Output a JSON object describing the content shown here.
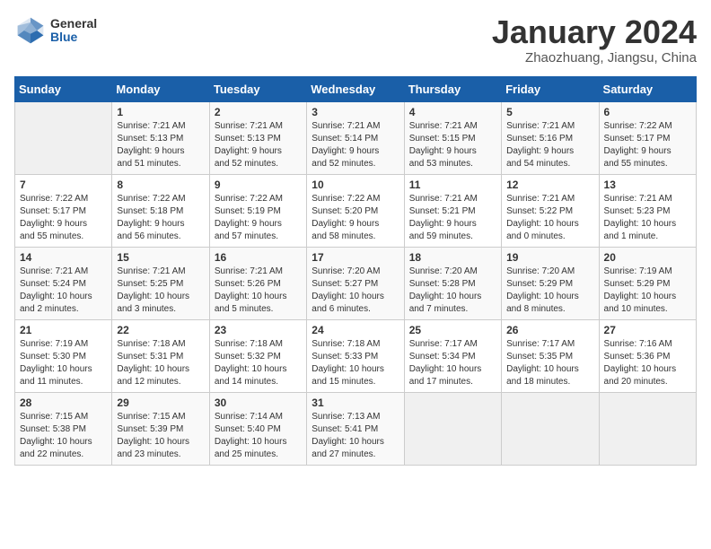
{
  "header": {
    "logo": {
      "line1": "General",
      "line2": "Blue"
    },
    "title": "January 2024",
    "location": "Zhaozhuang, Jiangsu, China"
  },
  "weekdays": [
    "Sunday",
    "Monday",
    "Tuesday",
    "Wednesday",
    "Thursday",
    "Friday",
    "Saturday"
  ],
  "weeks": [
    [
      {
        "day": "",
        "info": ""
      },
      {
        "day": "1",
        "info": "Sunrise: 7:21 AM\nSunset: 5:13 PM\nDaylight: 9 hours\nand 51 minutes."
      },
      {
        "day": "2",
        "info": "Sunrise: 7:21 AM\nSunset: 5:13 PM\nDaylight: 9 hours\nand 52 minutes."
      },
      {
        "day": "3",
        "info": "Sunrise: 7:21 AM\nSunset: 5:14 PM\nDaylight: 9 hours\nand 52 minutes."
      },
      {
        "day": "4",
        "info": "Sunrise: 7:21 AM\nSunset: 5:15 PM\nDaylight: 9 hours\nand 53 minutes."
      },
      {
        "day": "5",
        "info": "Sunrise: 7:21 AM\nSunset: 5:16 PM\nDaylight: 9 hours\nand 54 minutes."
      },
      {
        "day": "6",
        "info": "Sunrise: 7:22 AM\nSunset: 5:17 PM\nDaylight: 9 hours\nand 55 minutes."
      }
    ],
    [
      {
        "day": "7",
        "info": "Sunrise: 7:22 AM\nSunset: 5:17 PM\nDaylight: 9 hours\nand 55 minutes."
      },
      {
        "day": "8",
        "info": "Sunrise: 7:22 AM\nSunset: 5:18 PM\nDaylight: 9 hours\nand 56 minutes."
      },
      {
        "day": "9",
        "info": "Sunrise: 7:22 AM\nSunset: 5:19 PM\nDaylight: 9 hours\nand 57 minutes."
      },
      {
        "day": "10",
        "info": "Sunrise: 7:22 AM\nSunset: 5:20 PM\nDaylight: 9 hours\nand 58 minutes."
      },
      {
        "day": "11",
        "info": "Sunrise: 7:21 AM\nSunset: 5:21 PM\nDaylight: 9 hours\nand 59 minutes."
      },
      {
        "day": "12",
        "info": "Sunrise: 7:21 AM\nSunset: 5:22 PM\nDaylight: 10 hours\nand 0 minutes."
      },
      {
        "day": "13",
        "info": "Sunrise: 7:21 AM\nSunset: 5:23 PM\nDaylight: 10 hours\nand 1 minute."
      }
    ],
    [
      {
        "day": "14",
        "info": "Sunrise: 7:21 AM\nSunset: 5:24 PM\nDaylight: 10 hours\nand 2 minutes."
      },
      {
        "day": "15",
        "info": "Sunrise: 7:21 AM\nSunset: 5:25 PM\nDaylight: 10 hours\nand 3 minutes."
      },
      {
        "day": "16",
        "info": "Sunrise: 7:21 AM\nSunset: 5:26 PM\nDaylight: 10 hours\nand 5 minutes."
      },
      {
        "day": "17",
        "info": "Sunrise: 7:20 AM\nSunset: 5:27 PM\nDaylight: 10 hours\nand 6 minutes."
      },
      {
        "day": "18",
        "info": "Sunrise: 7:20 AM\nSunset: 5:28 PM\nDaylight: 10 hours\nand 7 minutes."
      },
      {
        "day": "19",
        "info": "Sunrise: 7:20 AM\nSunset: 5:29 PM\nDaylight: 10 hours\nand 8 minutes."
      },
      {
        "day": "20",
        "info": "Sunrise: 7:19 AM\nSunset: 5:29 PM\nDaylight: 10 hours\nand 10 minutes."
      }
    ],
    [
      {
        "day": "21",
        "info": "Sunrise: 7:19 AM\nSunset: 5:30 PM\nDaylight: 10 hours\nand 11 minutes."
      },
      {
        "day": "22",
        "info": "Sunrise: 7:18 AM\nSunset: 5:31 PM\nDaylight: 10 hours\nand 12 minutes."
      },
      {
        "day": "23",
        "info": "Sunrise: 7:18 AM\nSunset: 5:32 PM\nDaylight: 10 hours\nand 14 minutes."
      },
      {
        "day": "24",
        "info": "Sunrise: 7:18 AM\nSunset: 5:33 PM\nDaylight: 10 hours\nand 15 minutes."
      },
      {
        "day": "25",
        "info": "Sunrise: 7:17 AM\nSunset: 5:34 PM\nDaylight: 10 hours\nand 17 minutes."
      },
      {
        "day": "26",
        "info": "Sunrise: 7:17 AM\nSunset: 5:35 PM\nDaylight: 10 hours\nand 18 minutes."
      },
      {
        "day": "27",
        "info": "Sunrise: 7:16 AM\nSunset: 5:36 PM\nDaylight: 10 hours\nand 20 minutes."
      }
    ],
    [
      {
        "day": "28",
        "info": "Sunrise: 7:15 AM\nSunset: 5:38 PM\nDaylight: 10 hours\nand 22 minutes."
      },
      {
        "day": "29",
        "info": "Sunrise: 7:15 AM\nSunset: 5:39 PM\nDaylight: 10 hours\nand 23 minutes."
      },
      {
        "day": "30",
        "info": "Sunrise: 7:14 AM\nSunset: 5:40 PM\nDaylight: 10 hours\nand 25 minutes."
      },
      {
        "day": "31",
        "info": "Sunrise: 7:13 AM\nSunset: 5:41 PM\nDaylight: 10 hours\nand 27 minutes."
      },
      {
        "day": "",
        "info": ""
      },
      {
        "day": "",
        "info": ""
      },
      {
        "day": "",
        "info": ""
      }
    ]
  ]
}
